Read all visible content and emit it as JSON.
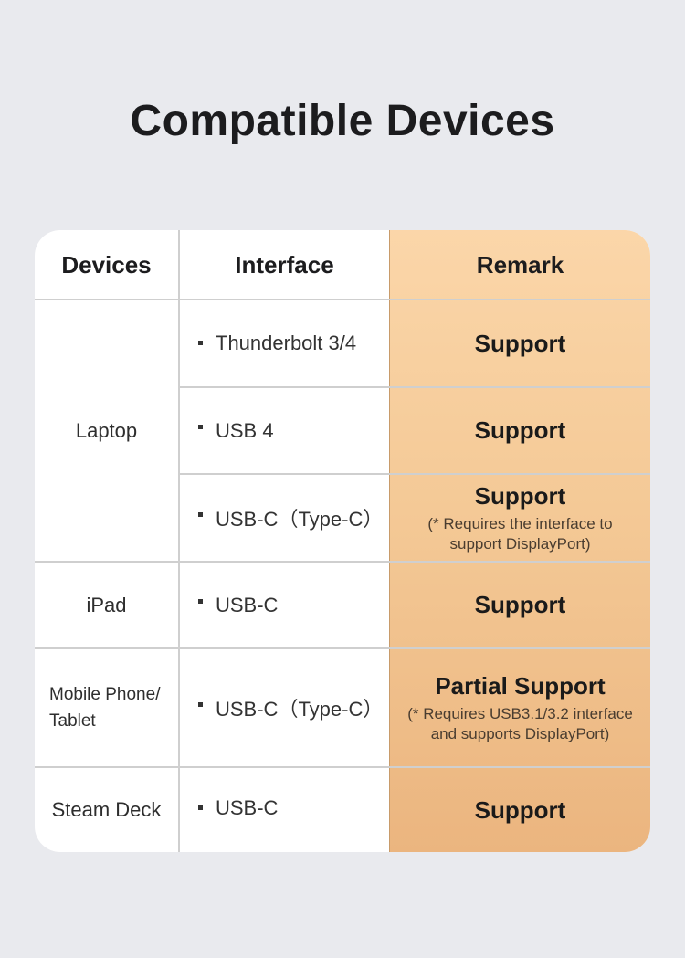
{
  "title": "Compatible Devices",
  "colors": {
    "background": "#e9eaee",
    "remark_column_top": "#fbd6a9",
    "remark_column_bottom": "#ebb57f",
    "text": "#1c1c1e"
  },
  "table": {
    "headers": [
      "Devices",
      "Interface",
      "Remark"
    ],
    "rows": [
      {
        "device": "Laptop",
        "interface": "Thunderbolt 3/4",
        "remark": "Support",
        "note": ""
      },
      {
        "device": "",
        "interface": "USB 4",
        "remark": "Support",
        "note": ""
      },
      {
        "device": "",
        "interface": "USB-C（Type-C）",
        "remark": "Support",
        "note": "(* Requires the interface to support DisplayPort)"
      },
      {
        "device": "iPad",
        "interface": "USB-C",
        "remark": "Support",
        "note": ""
      },
      {
        "device": "Mobile Phone/ Tablet",
        "interface": "USB-C（Type-C）",
        "remark": "Partial Support",
        "note": "(* Requires USB3.1/3.2 interface and supports DisplayPort)"
      },
      {
        "device": "Steam Deck",
        "interface": "USB-C",
        "remark": "Support",
        "note": ""
      }
    ]
  }
}
